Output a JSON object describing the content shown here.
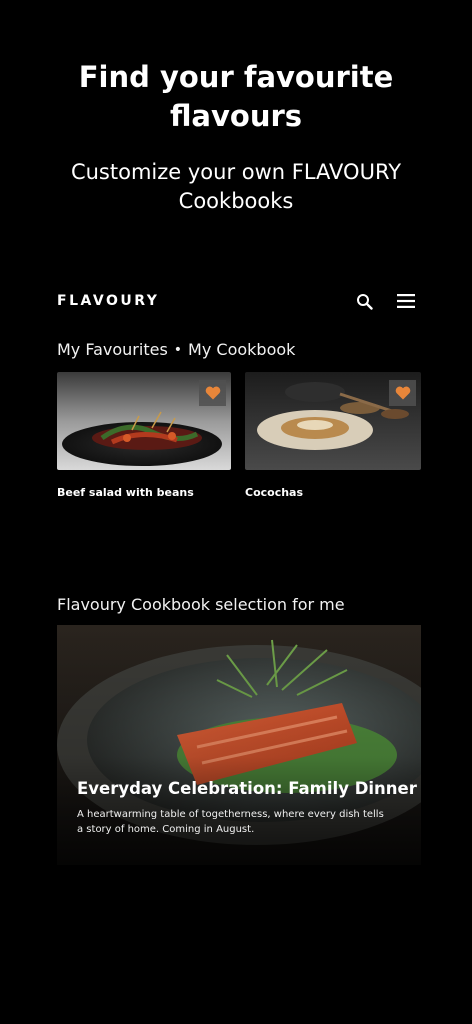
{
  "hero": {
    "title": "Find your favourite flavours",
    "subtitle": "Customize your own FLAVOURY Cookbooks"
  },
  "appbar": {
    "brand": "FLAVOURY",
    "search_icon": "search-icon",
    "menu_icon": "hamburger-menu-icon"
  },
  "favourites": {
    "tab_favourites": "My Favourites",
    "separator": "•",
    "tab_cookbook": "My Cookbook",
    "cards": [
      {
        "title": "Beef salad with beans",
        "favourite": true,
        "icon": "heart-icon"
      },
      {
        "title": "Cocochas",
        "favourite": true,
        "icon": "heart-icon"
      }
    ]
  },
  "selection": {
    "label": "Flavoury Cookbook selection for me",
    "feature": {
      "title": "Everyday Celebration: Family Dinner",
      "description": "A heartwarming table of togetherness, where every dish tells a story of home. Coming in August."
    }
  },
  "colors": {
    "background": "#000000",
    "text": "#ffffff",
    "heart": "#e8863a"
  }
}
